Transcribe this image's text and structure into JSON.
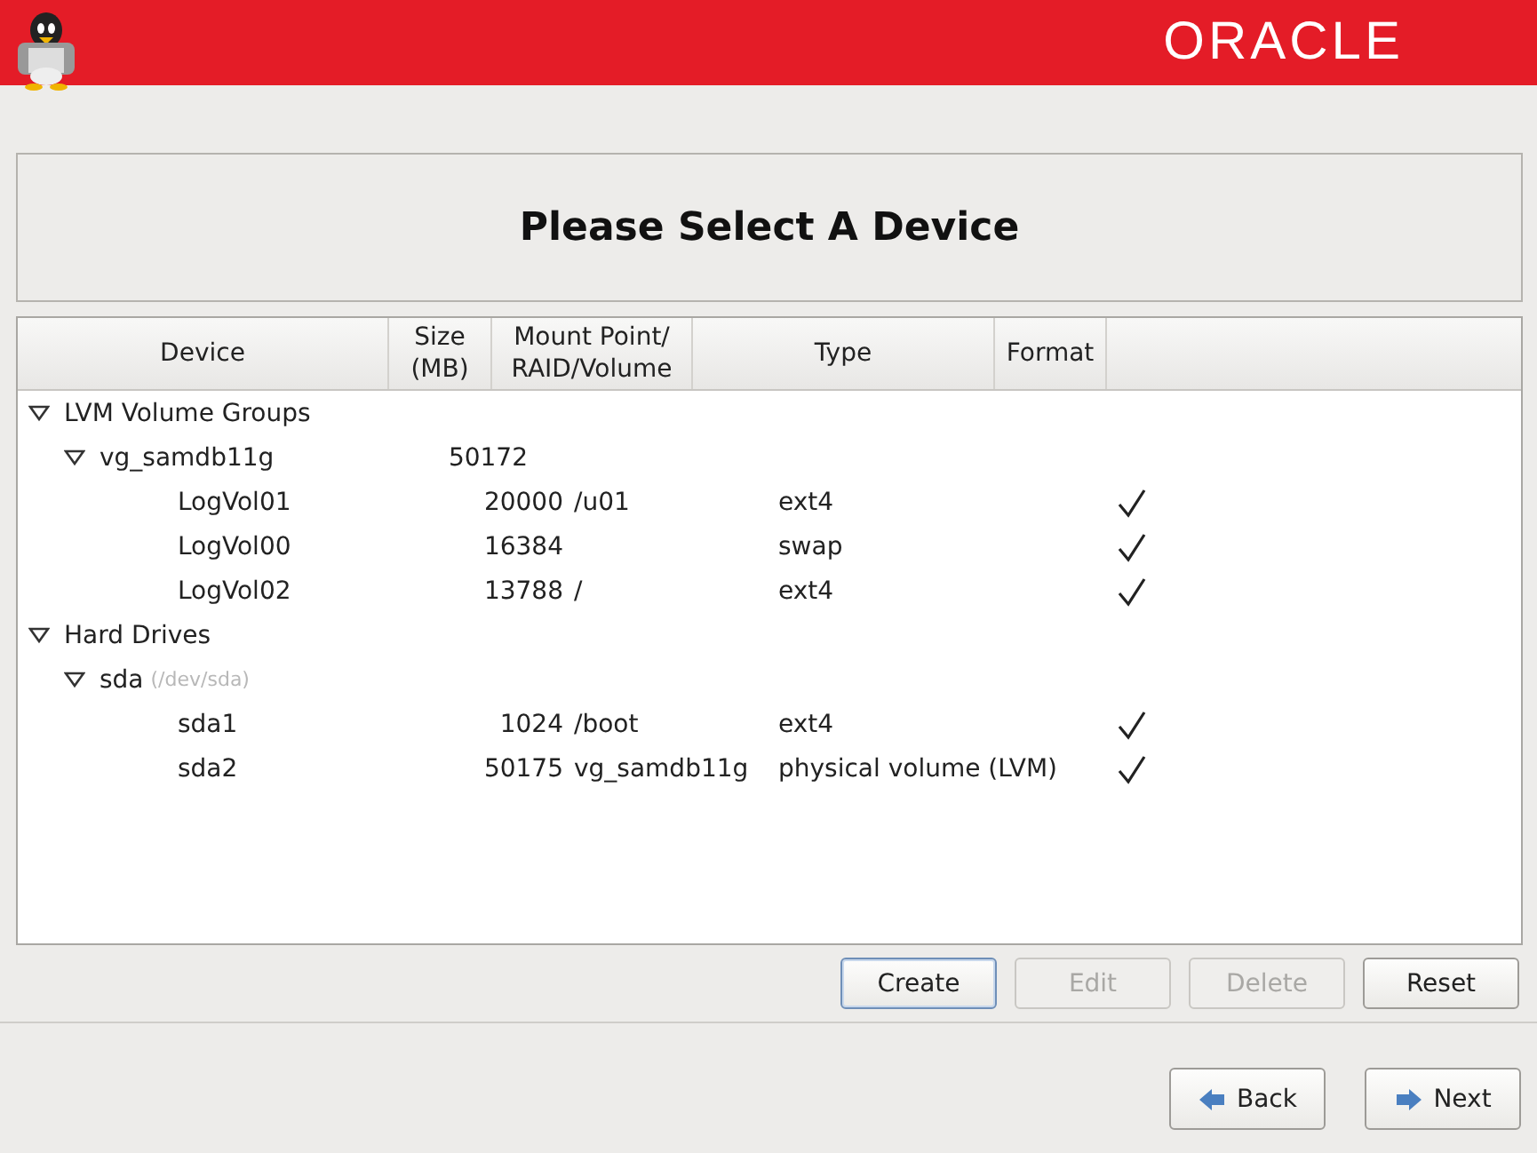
{
  "header": {
    "logo": "ORACLE"
  },
  "title": "Please Select A Device",
  "table": {
    "columns": [
      "Device",
      "Size\n(MB)",
      "Mount Point/\nRAID/Volume",
      "Type",
      "Format"
    ],
    "rows": [
      {
        "name": "LVM Volume Groups",
        "expanded": true,
        "children": [
          {
            "name": "vg_samdb11g",
            "size": "50172",
            "expanded": true,
            "children": [
              {
                "name": "LogVol01",
                "size": "20000",
                "mount": "/u01",
                "type": "ext4",
                "format": true
              },
              {
                "name": "LogVol00",
                "size": "16384",
                "type": "swap",
                "format": true
              },
              {
                "name": "LogVol02",
                "size": "13788",
                "mount": "/",
                "type": "ext4",
                "format": true
              }
            ]
          }
        ]
      },
      {
        "name": "Hard Drives",
        "expanded": true,
        "children": [
          {
            "name": "sda",
            "note": "(/dev/sda)",
            "expanded": true,
            "children": [
              {
                "name": "sda1",
                "size": "1024",
                "mount": "/boot",
                "type": "ext4",
                "format": true
              },
              {
                "name": "sda2",
                "size": "50175",
                "mount": "vg_samdb11g",
                "type": "physical volume (LVM)",
                "format": true
              }
            ]
          }
        ]
      }
    ]
  },
  "actions": [
    {
      "label": "Create",
      "disabled": false,
      "focused": true
    },
    {
      "label": "Edit",
      "disabled": true,
      "focused": false
    },
    {
      "label": "Delete",
      "disabled": true,
      "focused": false
    },
    {
      "label": "Reset",
      "disabled": false,
      "focused": false
    }
  ],
  "nav": [
    {
      "label": "Back",
      "kind": "back"
    },
    {
      "label": "Next",
      "kind": "next"
    }
  ]
}
